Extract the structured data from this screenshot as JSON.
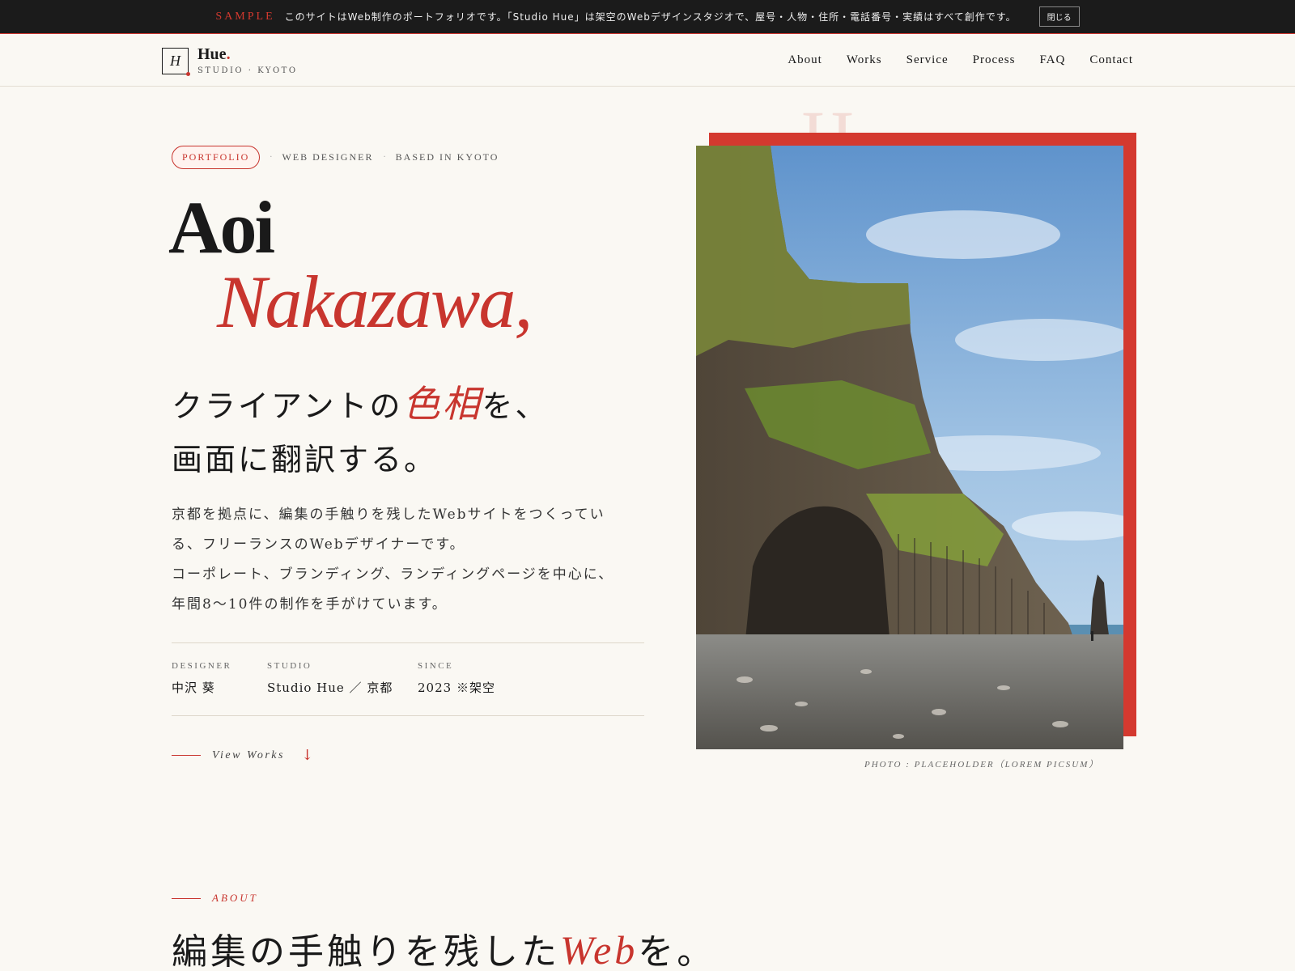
{
  "announcement": {
    "tag": "SAMPLE",
    "message": "このサイトはWeb制作のポートフォリオです。「Studio Hue」は架空のWebデザインスタジオで、屋号・人物・住所・電話番号・実績はすべて創作です。",
    "close_label": "閉じる"
  },
  "header": {
    "logo_mark": "H",
    "logo_name": "Hue",
    "logo_dot": ".",
    "logo_sub": "STUDIO · KYOTO",
    "nav": [
      "About",
      "Works",
      "Service",
      "Process",
      "FAQ",
      "Contact"
    ]
  },
  "hero": {
    "badge": "PORTFOLIO",
    "separator": "·",
    "meta1": "WEB DESIGNER",
    "meta2": "BASED IN KYOTO",
    "first_name": "Aoi",
    "last_name": "Nakazawa,",
    "tagline_pre": "クライアントの",
    "tagline_accent": "色相",
    "tagline_post": "を、",
    "tagline_line2": "画面に翻訳する。",
    "intro": [
      "京都を拠点に、編集の手触りを残したWebサイトをつくってい",
      "る、フリーランスのWebデザイナーです。",
      "コーポレート、ブランディング、ランディングページを中心に、",
      "年間8〜10件の制作を手がけています。"
    ],
    "facts": [
      {
        "label": "DESIGNER",
        "value": "中沢 葵"
      },
      {
        "label": "STUDIO",
        "value": "Studio Hue ／ 京都"
      },
      {
        "label": "SINCE",
        "value": "2023 ※架空"
      }
    ],
    "view_works": "View Works",
    "view_arrow": "↓",
    "ghost_text": "H",
    "photo_caption": "PHOTO : PLACEHOLDER（LOREM PICSUM）"
  },
  "about": {
    "label": "ABOUT",
    "title_pre": "編集の手触りを残した",
    "title_accent": "Web",
    "title_post": "を。"
  },
  "colors": {
    "accent": "#c8352e",
    "background": "#faf8f3",
    "announcement_bg": "#1b1b1b"
  }
}
